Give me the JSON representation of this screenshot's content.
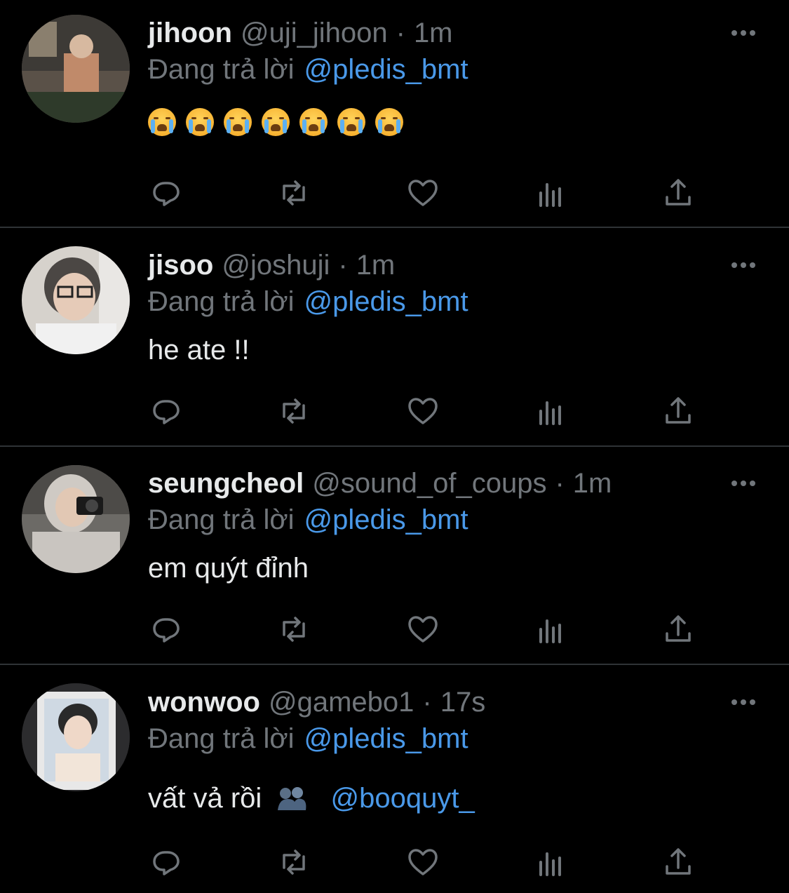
{
  "reply_label": "Đang trả lời",
  "tweets": [
    {
      "name": "jihoon",
      "handle": "@uji_jihoon",
      "time": "1m",
      "reply_to": "@pledis_bmt",
      "text": "",
      "emoji_count": 7,
      "emoji": "crying-face"
    },
    {
      "name": "jisoo",
      "handle": "@joshuji",
      "time": "1m",
      "reply_to": "@pledis_bmt",
      "text": "he ate !!"
    },
    {
      "name": "seungcheol",
      "handle": "@sound_of_coups",
      "time": "1m",
      "reply_to": "@pledis_bmt",
      "text": "em quýt đỉnh"
    },
    {
      "name": "wonwoo",
      "handle": "@gamebo1",
      "time": "17s",
      "reply_to": "@pledis_bmt",
      "text": "vất vả rồi",
      "emoji": "people-hugging",
      "mention": "@booquyt_"
    }
  ],
  "actions": [
    "reply-icon",
    "retweet-icon",
    "like-icon",
    "views-icon",
    "share-icon"
  ],
  "colors": {
    "background": "#000000",
    "text": "#e7e9ea",
    "muted": "#71767b",
    "link": "#4a99e9",
    "divider": "#2f3336"
  }
}
